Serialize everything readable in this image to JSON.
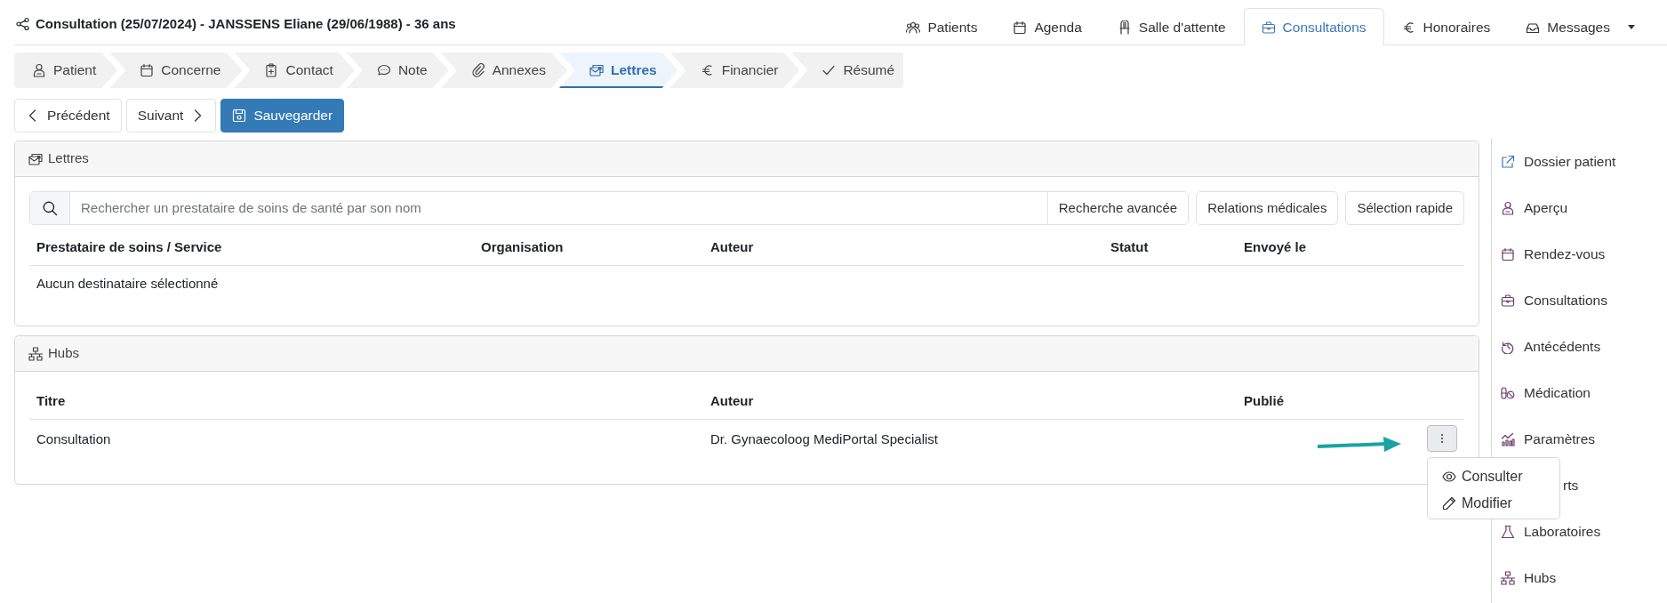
{
  "header": {
    "title": "Consultation (25/07/2024) - JANSSENS Eliane (29/06/1988) - 36 ans"
  },
  "main_tabs": [
    {
      "label": "Patients",
      "selected": false,
      "dropdown": false
    },
    {
      "label": "Agenda",
      "selected": false,
      "dropdown": false
    },
    {
      "label": "Salle d'attente",
      "selected": false,
      "dropdown": false
    },
    {
      "label": "Consultations",
      "selected": true,
      "dropdown": false
    },
    {
      "label": "Honoraires",
      "selected": false,
      "dropdown": false
    },
    {
      "label": "Messages",
      "selected": false,
      "dropdown": true
    }
  ],
  "steps": [
    {
      "label": "Patient",
      "selected": false
    },
    {
      "label": "Concerne",
      "selected": false
    },
    {
      "label": "Contact",
      "selected": false
    },
    {
      "label": "Note",
      "selected": false
    },
    {
      "label": "Annexes",
      "selected": false
    },
    {
      "label": "Lettres",
      "selected": true
    },
    {
      "label": "Financier",
      "selected": false
    },
    {
      "label": "Résumé",
      "selected": false
    }
  ],
  "actions": [
    {
      "label": "Précédent",
      "kind": "prev"
    },
    {
      "label": "Suivant",
      "kind": "next"
    },
    {
      "label": "Sauvegarder",
      "kind": "save"
    }
  ],
  "letters": {
    "title": "Lettres",
    "search": {
      "placeholder": "Rechercher un prestataire de soins de santé par son nom"
    },
    "buttons": [
      "Recherche avancée",
      "Relations médicales",
      "Sélection rapide"
    ],
    "columns": [
      "Prestataire de soins / Service",
      "Organisation",
      "Auteur",
      "Statut",
      "Envoyé le"
    ],
    "empty": "Aucun destinataire sélectionné"
  },
  "hubs": {
    "title": "Hubs",
    "columns": [
      "Titre",
      "Auteur",
      "Publié"
    ],
    "rows": [
      {
        "title": "Consultation",
        "author": "Dr. Gynaecoloog MediPortal Specialist"
      }
    ]
  },
  "row_menu": {
    "items": [
      {
        "label": "Consulter"
      },
      {
        "label": "Modifier"
      }
    ]
  },
  "sidebar": {
    "items": [
      {
        "label": "Dossier patient"
      },
      {
        "label": "Aperçu"
      },
      {
        "label": "Rendez-vous"
      },
      {
        "label": "Consultations"
      },
      {
        "label": "Antécédents"
      },
      {
        "label": "Médication"
      },
      {
        "label": "Paramètres"
      },
      {
        "label": "rts"
      },
      {
        "label": "Laboratoires"
      },
      {
        "label": "Hubs"
      }
    ]
  }
}
